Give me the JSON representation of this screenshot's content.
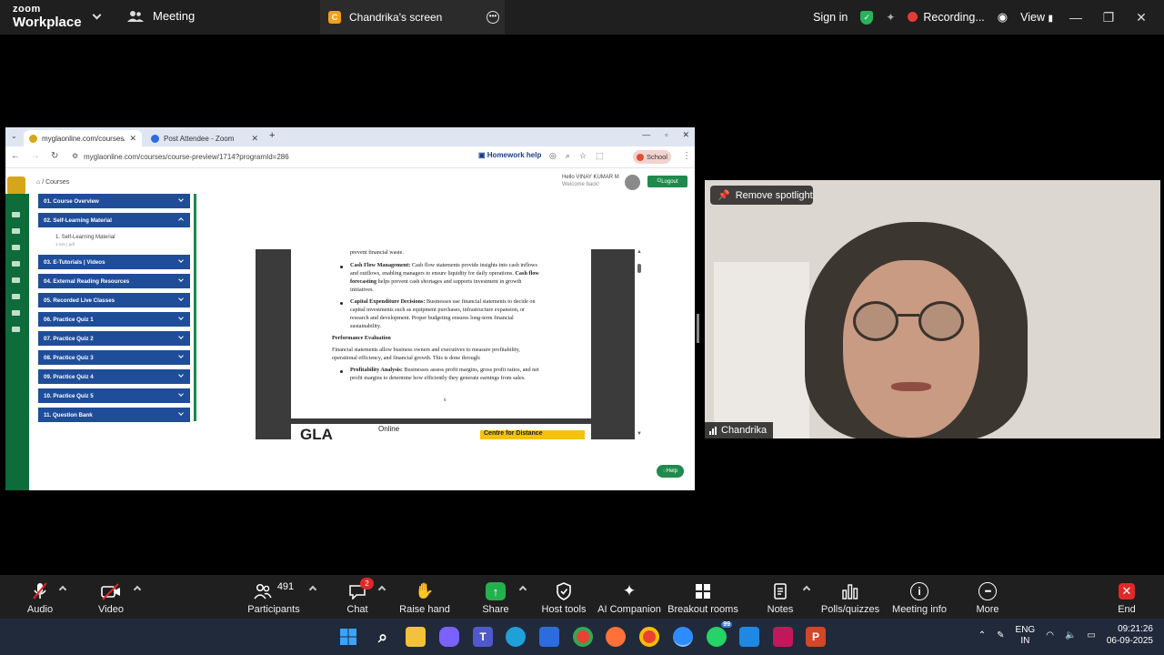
{
  "zoom": {
    "brand_top": "zoom",
    "brand_bottom": "Workplace",
    "meeting_tab": "Meeting",
    "share_tab": "Chandrika's screen",
    "share_tab_badge": "C",
    "sign_in": "Sign in",
    "recording": "Recording...",
    "view": "View"
  },
  "browser": {
    "tab1": "myglaonline.com/courses/cour",
    "tab2": "Post Attendee - Zoom",
    "url": "myglaonline.com/courses/course-preview/1714?programId=286",
    "homework": "Homework help",
    "school": "School",
    "breadcrumb": "/ Courses",
    "hello_line1": "Hello VINAY KUMAR M",
    "hello_line2": "Welcome back!",
    "logout": "Logout",
    "help": "Help"
  },
  "menu": [
    {
      "label": "01. Course Overview",
      "open": false
    },
    {
      "label": "02. Self-Learning Material",
      "open": true
    },
    {
      "label": "03. E-Tutorials | Videos",
      "open": false
    },
    {
      "label": "04. External Reading Resources",
      "open": false
    },
    {
      "label": "05. Recorded Live Classes",
      "open": false
    },
    {
      "label": "06. Practice Quiz 1",
      "open": false
    },
    {
      "label": "07. Practice Quiz 2",
      "open": false
    },
    {
      "label": "08. Practice Quiz 3",
      "open": false
    },
    {
      "label": "09. Practice Quiz 4",
      "open": false
    },
    {
      "label": "10. Practice Quiz 5",
      "open": false
    },
    {
      "label": "11. Question Bank",
      "open": false
    }
  ],
  "submenu": {
    "item": "1. Self-Learning Material",
    "meta": "1 min | pdf"
  },
  "pdf": {
    "line0": "prevent financial waste.",
    "cf_title": "Cash Flow Management:",
    "cf_l1": " Cash flow statements provide insights into cash inflows",
    "cf_l2": "and outflows, enabling managers to ensure liquidity for daily operations.",
    "cf_l2b": " Cash flow",
    "cf_l3b": "forecasting",
    "cf_l3": " helps prevent cash shortages and supports investment in growth",
    "cf_l4": "initiatives.",
    "ce_title": "Capital Expenditure Decisions:",
    "ce_l1": " Businesses use financial statements to decide on",
    "ce_l2": "capital investments such as equipment purchases, infrastructure expansion, or",
    "ce_l3": "research and development. Proper budgeting ensures long-term financial",
    "ce_l4": "sustainability.",
    "pe_heading": "Performance Evaluation",
    "pe_l1": "Financial statements allow business owners and executives to measure profitability,",
    "pe_l2": "operational efficiency, and financial growth. This is done through:",
    "pa_title": "Profitability Analysis:",
    "pa_l1": " Businesses assess profit margins, gross profit ratios, and net",
    "pa_l2": "profit margins to determine how efficiently they generate earnings from sales.",
    "page_num": "6",
    "footer_logo": "GLA",
    "footer_online": "Online",
    "footer_cdl": "Centre for Distance"
  },
  "video": {
    "remove_spotlight": "Remove spotlight",
    "participant_name": "Chandrika"
  },
  "toolbar": {
    "audio": "Audio",
    "video": "Video",
    "participants": "Participants",
    "participants_count": "491",
    "chat": "Chat",
    "chat_badge": "2",
    "raise_hand": "Raise hand",
    "share": "Share",
    "host_tools": "Host tools",
    "ai_companion": "AI Companion",
    "breakout_rooms": "Breakout rooms",
    "notes": "Notes",
    "polls": "Polls/quizzes",
    "meeting_info": "Meeting info",
    "more": "More",
    "end": "End"
  },
  "taskbar": {
    "whatsapp_badge": "99",
    "lang_top": "ENG",
    "lang_bottom": "IN",
    "time": "09:21:26",
    "date": "06-09-2025"
  }
}
